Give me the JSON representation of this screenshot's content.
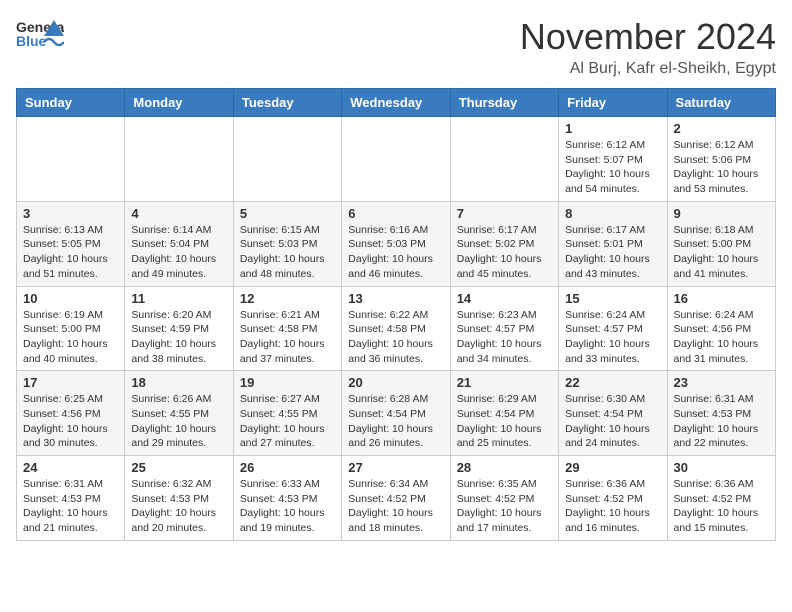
{
  "header": {
    "logo_general": "General",
    "logo_blue": "Blue",
    "month_title": "November 2024",
    "location": "Al Burj, Kafr el-Sheikh, Egypt"
  },
  "calendar": {
    "days_of_week": [
      "Sunday",
      "Monday",
      "Tuesday",
      "Wednesday",
      "Thursday",
      "Friday",
      "Saturday"
    ],
    "weeks": [
      [
        {
          "day": "",
          "info": ""
        },
        {
          "day": "",
          "info": ""
        },
        {
          "day": "",
          "info": ""
        },
        {
          "day": "",
          "info": ""
        },
        {
          "day": "",
          "info": ""
        },
        {
          "day": "1",
          "info": "Sunrise: 6:12 AM\nSunset: 5:07 PM\nDaylight: 10 hours and 54 minutes."
        },
        {
          "day": "2",
          "info": "Sunrise: 6:12 AM\nSunset: 5:06 PM\nDaylight: 10 hours and 53 minutes."
        }
      ],
      [
        {
          "day": "3",
          "info": "Sunrise: 6:13 AM\nSunset: 5:05 PM\nDaylight: 10 hours and 51 minutes."
        },
        {
          "day": "4",
          "info": "Sunrise: 6:14 AM\nSunset: 5:04 PM\nDaylight: 10 hours and 49 minutes."
        },
        {
          "day": "5",
          "info": "Sunrise: 6:15 AM\nSunset: 5:03 PM\nDaylight: 10 hours and 48 minutes."
        },
        {
          "day": "6",
          "info": "Sunrise: 6:16 AM\nSunset: 5:03 PM\nDaylight: 10 hours and 46 minutes."
        },
        {
          "day": "7",
          "info": "Sunrise: 6:17 AM\nSunset: 5:02 PM\nDaylight: 10 hours and 45 minutes."
        },
        {
          "day": "8",
          "info": "Sunrise: 6:17 AM\nSunset: 5:01 PM\nDaylight: 10 hours and 43 minutes."
        },
        {
          "day": "9",
          "info": "Sunrise: 6:18 AM\nSunset: 5:00 PM\nDaylight: 10 hours and 41 minutes."
        }
      ],
      [
        {
          "day": "10",
          "info": "Sunrise: 6:19 AM\nSunset: 5:00 PM\nDaylight: 10 hours and 40 minutes."
        },
        {
          "day": "11",
          "info": "Sunrise: 6:20 AM\nSunset: 4:59 PM\nDaylight: 10 hours and 38 minutes."
        },
        {
          "day": "12",
          "info": "Sunrise: 6:21 AM\nSunset: 4:58 PM\nDaylight: 10 hours and 37 minutes."
        },
        {
          "day": "13",
          "info": "Sunrise: 6:22 AM\nSunset: 4:58 PM\nDaylight: 10 hours and 36 minutes."
        },
        {
          "day": "14",
          "info": "Sunrise: 6:23 AM\nSunset: 4:57 PM\nDaylight: 10 hours and 34 minutes."
        },
        {
          "day": "15",
          "info": "Sunrise: 6:24 AM\nSunset: 4:57 PM\nDaylight: 10 hours and 33 minutes."
        },
        {
          "day": "16",
          "info": "Sunrise: 6:24 AM\nSunset: 4:56 PM\nDaylight: 10 hours and 31 minutes."
        }
      ],
      [
        {
          "day": "17",
          "info": "Sunrise: 6:25 AM\nSunset: 4:56 PM\nDaylight: 10 hours and 30 minutes."
        },
        {
          "day": "18",
          "info": "Sunrise: 6:26 AM\nSunset: 4:55 PM\nDaylight: 10 hours and 29 minutes."
        },
        {
          "day": "19",
          "info": "Sunrise: 6:27 AM\nSunset: 4:55 PM\nDaylight: 10 hours and 27 minutes."
        },
        {
          "day": "20",
          "info": "Sunrise: 6:28 AM\nSunset: 4:54 PM\nDaylight: 10 hours and 26 minutes."
        },
        {
          "day": "21",
          "info": "Sunrise: 6:29 AM\nSunset: 4:54 PM\nDaylight: 10 hours and 25 minutes."
        },
        {
          "day": "22",
          "info": "Sunrise: 6:30 AM\nSunset: 4:54 PM\nDaylight: 10 hours and 24 minutes."
        },
        {
          "day": "23",
          "info": "Sunrise: 6:31 AM\nSunset: 4:53 PM\nDaylight: 10 hours and 22 minutes."
        }
      ],
      [
        {
          "day": "24",
          "info": "Sunrise: 6:31 AM\nSunset: 4:53 PM\nDaylight: 10 hours and 21 minutes."
        },
        {
          "day": "25",
          "info": "Sunrise: 6:32 AM\nSunset: 4:53 PM\nDaylight: 10 hours and 20 minutes."
        },
        {
          "day": "26",
          "info": "Sunrise: 6:33 AM\nSunset: 4:53 PM\nDaylight: 10 hours and 19 minutes."
        },
        {
          "day": "27",
          "info": "Sunrise: 6:34 AM\nSunset: 4:52 PM\nDaylight: 10 hours and 18 minutes."
        },
        {
          "day": "28",
          "info": "Sunrise: 6:35 AM\nSunset: 4:52 PM\nDaylight: 10 hours and 17 minutes."
        },
        {
          "day": "29",
          "info": "Sunrise: 6:36 AM\nSunset: 4:52 PM\nDaylight: 10 hours and 16 minutes."
        },
        {
          "day": "30",
          "info": "Sunrise: 6:36 AM\nSunset: 4:52 PM\nDaylight: 10 hours and 15 minutes."
        }
      ]
    ]
  }
}
